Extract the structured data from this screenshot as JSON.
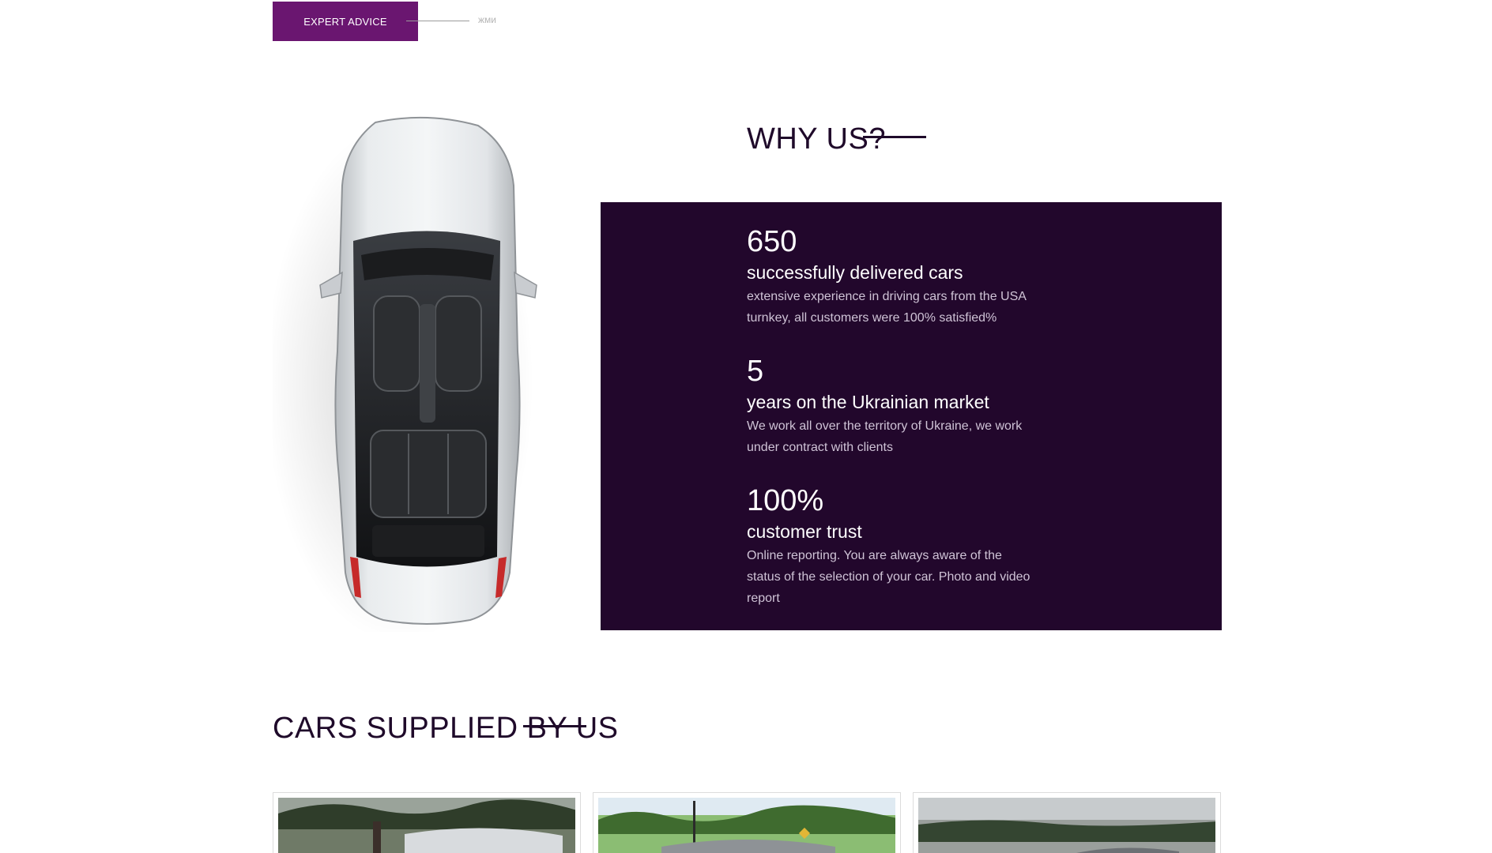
{
  "cta": {
    "label": "EXPERT ADVICE",
    "hint": "жми"
  },
  "why_us": {
    "title": "WHY US?",
    "stats": [
      {
        "number": "650",
        "title": "successfully delivered cars",
        "description": "extensive experience in driving cars from the USA turnkey, all customers were 100% satisfied%"
      },
      {
        "number": "5",
        "title": "years on the Ukrainian market",
        "description": "We work all over the territory of Ukraine, we work under contract with clients"
      },
      {
        "number": "100%",
        "title": "customer trust",
        "description": "Online reporting. You are always aware of the status of the selection of your car. Photo and video report"
      }
    ]
  },
  "cars_supplied": {
    "title": "CARS SUPPLIED BY US"
  },
  "colors": {
    "brand_purple": "#6a1670",
    "panel_dark": "#22072c",
    "heading": "#1f0a2a"
  }
}
